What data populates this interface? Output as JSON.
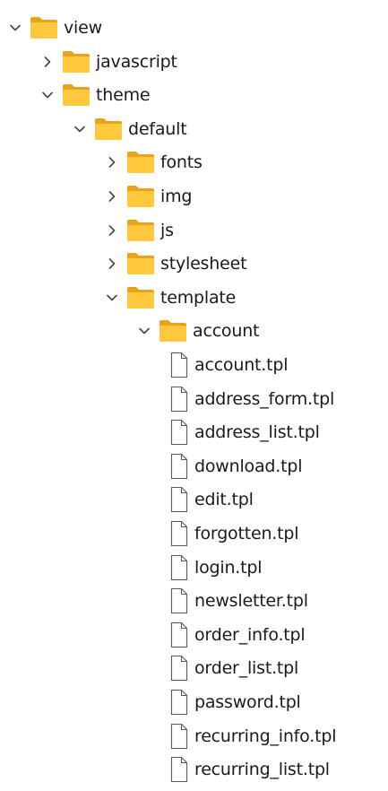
{
  "tree": {
    "nodes": [
      {
        "label": "view",
        "type": "folder",
        "state": "expanded",
        "depth": 0
      },
      {
        "label": "javascript",
        "type": "folder",
        "state": "collapsed",
        "depth": 1
      },
      {
        "label": "theme",
        "type": "folder",
        "state": "expanded",
        "depth": 1
      },
      {
        "label": "default",
        "type": "folder",
        "state": "expanded",
        "depth": 2
      },
      {
        "label": "fonts",
        "type": "folder",
        "state": "collapsed",
        "depth": 3
      },
      {
        "label": "img",
        "type": "folder",
        "state": "collapsed",
        "depth": 3
      },
      {
        "label": "js",
        "type": "folder",
        "state": "collapsed",
        "depth": 3
      },
      {
        "label": "stylesheet",
        "type": "folder",
        "state": "collapsed",
        "depth": 3
      },
      {
        "label": "template",
        "type": "folder",
        "state": "expanded",
        "depth": 3
      },
      {
        "label": "account",
        "type": "folder",
        "state": "expanded",
        "depth": 4
      },
      {
        "label": "account.tpl",
        "type": "file",
        "depth": 5
      },
      {
        "label": "address_form.tpl",
        "type": "file",
        "depth": 5
      },
      {
        "label": "address_list.tpl",
        "type": "file",
        "depth": 5
      },
      {
        "label": "download.tpl",
        "type": "file",
        "depth": 5
      },
      {
        "label": "edit.tpl",
        "type": "file",
        "depth": 5
      },
      {
        "label": "forgotten.tpl",
        "type": "file",
        "depth": 5
      },
      {
        "label": "login.tpl",
        "type": "file",
        "depth": 5
      },
      {
        "label": "newsletter.tpl",
        "type": "file",
        "depth": 5
      },
      {
        "label": "order_info.tpl",
        "type": "file",
        "depth": 5
      },
      {
        "label": "order_list.tpl",
        "type": "file",
        "depth": 5
      },
      {
        "label": "password.tpl",
        "type": "file",
        "depth": 5
      },
      {
        "label": "recurring_info.tpl",
        "type": "file",
        "depth": 5
      },
      {
        "label": "recurring_list.tpl",
        "type": "file",
        "depth": 5
      }
    ]
  },
  "colors": {
    "folder_back": "#E8A31B",
    "folder_front": "#FFC83D",
    "file_stroke": "#5a5a5a",
    "chevron": "#444444",
    "text": "#1a1a1a"
  },
  "icons": {
    "expanded": "chevron-down-icon",
    "collapsed": "chevron-right-icon",
    "folder": "folder-icon",
    "file": "file-icon"
  }
}
